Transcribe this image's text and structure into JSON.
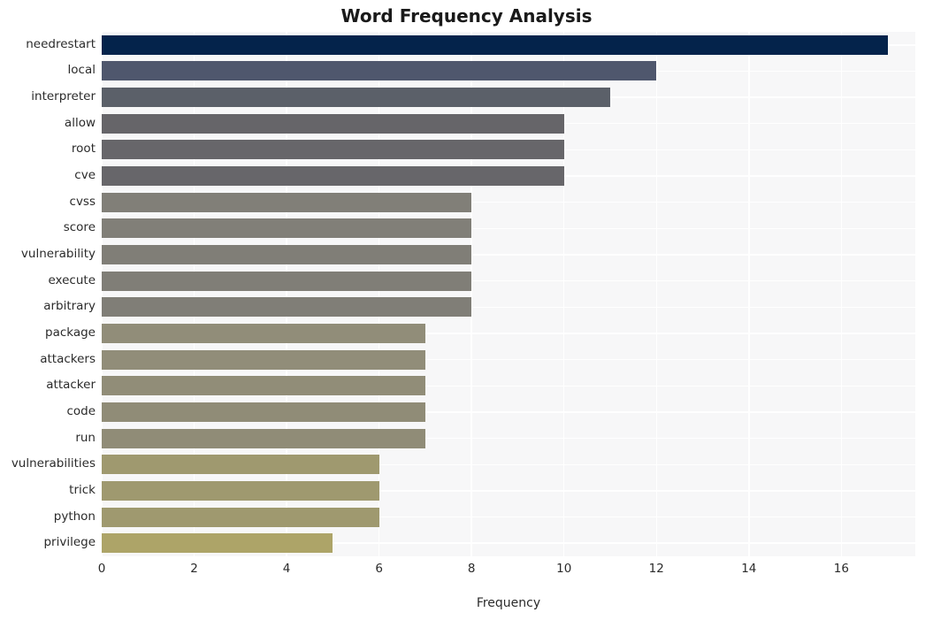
{
  "chart_data": {
    "type": "bar",
    "orientation": "horizontal",
    "title": "Word Frequency Analysis",
    "xlabel": "Frequency",
    "ylabel": "",
    "categories": [
      "needrestart",
      "local",
      "interpreter",
      "allow",
      "root",
      "cve",
      "cvss",
      "score",
      "vulnerability",
      "execute",
      "arbitrary",
      "package",
      "attackers",
      "attacker",
      "code",
      "run",
      "vulnerabilities",
      "trick",
      "python",
      "privilege"
    ],
    "values": [
      17,
      12,
      11,
      10,
      10,
      10,
      8,
      8,
      8,
      8,
      8,
      7,
      7,
      7,
      7,
      7,
      6,
      6,
      6,
      5
    ],
    "bar_colors": [
      "#04234b",
      "#4f576d",
      "#5b6069",
      "#666569",
      "#67666a",
      "#67666a",
      "#817f78",
      "#817f78",
      "#807e77",
      "#807e77",
      "#807e77",
      "#918d79",
      "#918d79",
      "#918d78",
      "#908c77",
      "#908c77",
      "#9f996f",
      "#9f996f",
      "#9f996f",
      "#ada468"
    ],
    "xlim": [
      0,
      17.6
    ],
    "xticks": [
      0,
      2,
      4,
      6,
      8,
      10,
      12,
      14,
      16
    ],
    "xticklabels": [
      "0",
      "2",
      "4",
      "6",
      "8",
      "10",
      "12",
      "14",
      "16"
    ],
    "grid": true,
    "grid_color": "#ffffff",
    "plot_background": "#f7f7f8",
    "figure_background": "#ffffff",
    "legend": null,
    "style": "whitegrid"
  }
}
